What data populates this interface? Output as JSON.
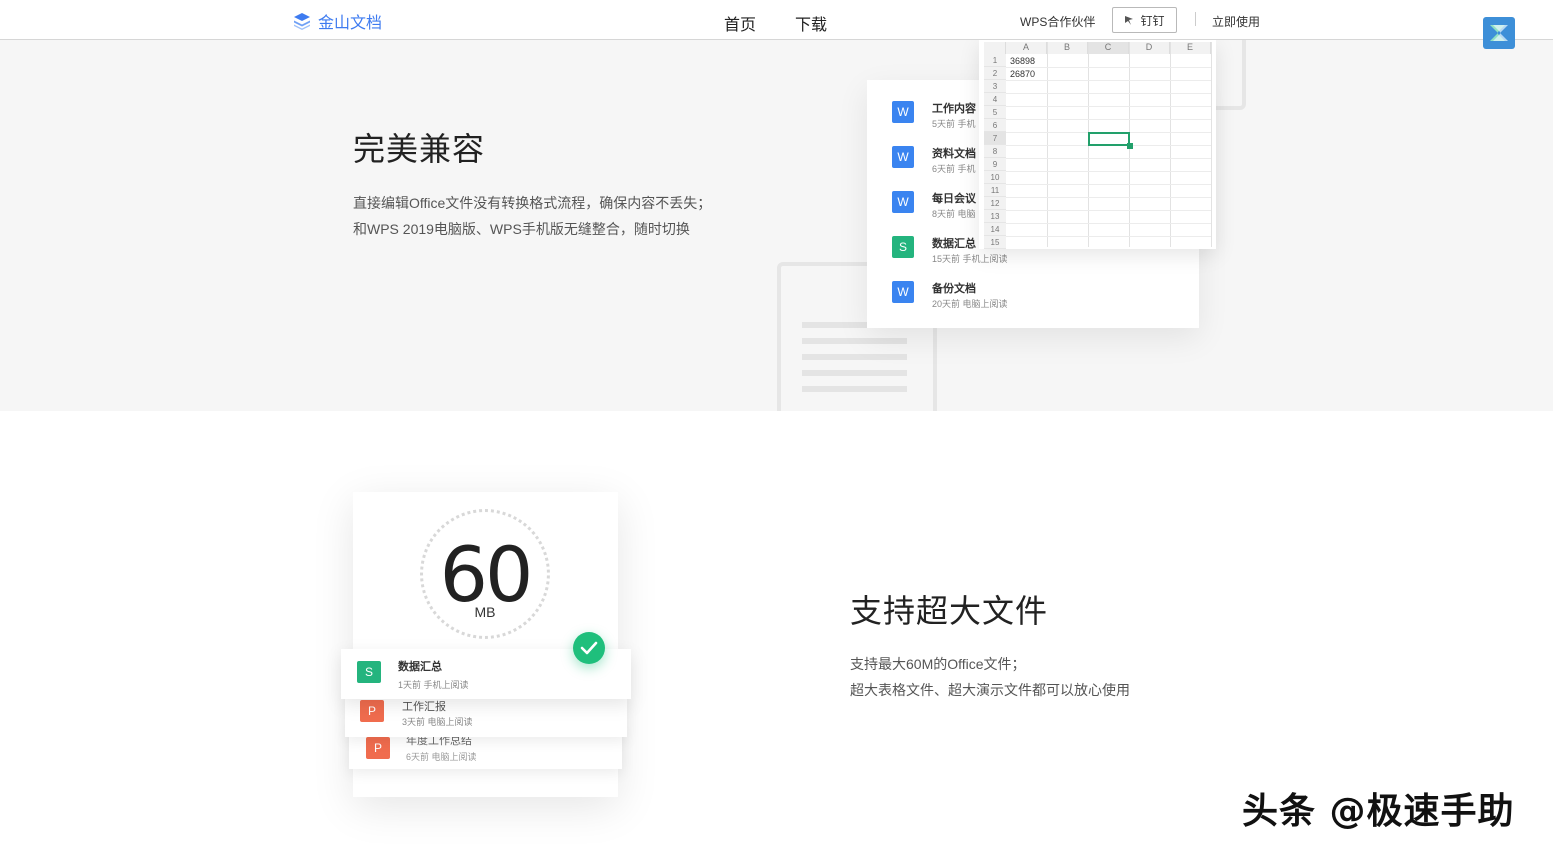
{
  "header": {
    "logo_text": "金山文档",
    "nav": {
      "home": "首页",
      "download": "下载"
    },
    "partner": "WPS合作伙伴",
    "dingding": "钉钉",
    "use_now": "立即使用"
  },
  "section_compat": {
    "title": "完美兼容",
    "desc_line1": "直接编辑Office文件没有转换格式流程，确保内容不丢失；",
    "desc_line2": "和WPS 2019电脑版、WPS手机版无缝整合，随时切换",
    "doc_list": [
      {
        "icon": "W",
        "name": "工作内容",
        "meta": "5天前  手机"
      },
      {
        "icon": "W",
        "name": "资料文档",
        "meta": "6天前  手机"
      },
      {
        "icon": "W",
        "name": "每日会议",
        "meta": "8天前  电脑"
      },
      {
        "icon": "S",
        "name": "数据汇总",
        "meta": "15天前  手机上阅读"
      },
      {
        "icon": "W",
        "name": "备份文档",
        "meta": "20天前  电脑上阅读"
      }
    ],
    "sheet": {
      "columns": [
        "A",
        "B",
        "C",
        "D",
        "E"
      ],
      "rows": [
        "1",
        "2",
        "3",
        "4",
        "5",
        "6",
        "7",
        "8",
        "9",
        "10",
        "11",
        "12",
        "13",
        "14",
        "15"
      ],
      "a1": "36898",
      "a2": "26870"
    }
  },
  "section_large": {
    "size_number": "60",
    "size_unit": "MB",
    "files": [
      {
        "icon": "S",
        "name": "数据汇总",
        "meta": "1天前  手机上阅读"
      },
      {
        "icon": "P",
        "name": "工作汇报",
        "meta": "3天前  电脑上阅读"
      },
      {
        "icon": "P",
        "name": "年度工作总结",
        "meta": "6天前  电脑上阅读"
      }
    ],
    "title": "支持超大文件",
    "desc_line1": "支持最大60M的Office文件；",
    "desc_line2": "超大表格文件、超大演示文件都可以放心使用"
  },
  "watermark": "头条 @极速手助",
  "colors": {
    "brand": "#3e7bf0",
    "word": "#3a84f0",
    "sheet": "#24b47e",
    "ppt": "#f06c4e",
    "check": "#1fbf7c"
  }
}
